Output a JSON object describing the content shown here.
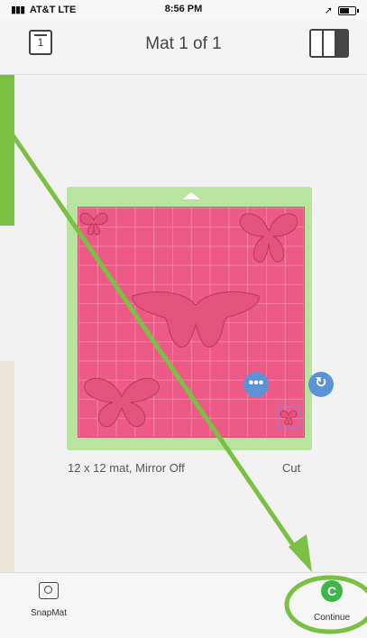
{
  "status": {
    "carrier": "AT&T",
    "network": "LTE",
    "time": "8:56 PM"
  },
  "nav": {
    "mat_count": "1",
    "title": "Mat 1 of 1"
  },
  "mat": {
    "info": "12 x 12 mat, Mirror Off",
    "action": "Cut",
    "more_label": "•••",
    "rotate_label": "↻"
  },
  "bottom": {
    "snapmat_label": "SnapMat",
    "continue_label": "Continue",
    "continue_icon": "C"
  },
  "colors": {
    "mat_green": "#b9e4a0",
    "grid_pink": "#ee5a87",
    "accent_blue": "#5b93d6",
    "continue_green": "#3fb44a",
    "annotation_green": "#7ac043"
  }
}
